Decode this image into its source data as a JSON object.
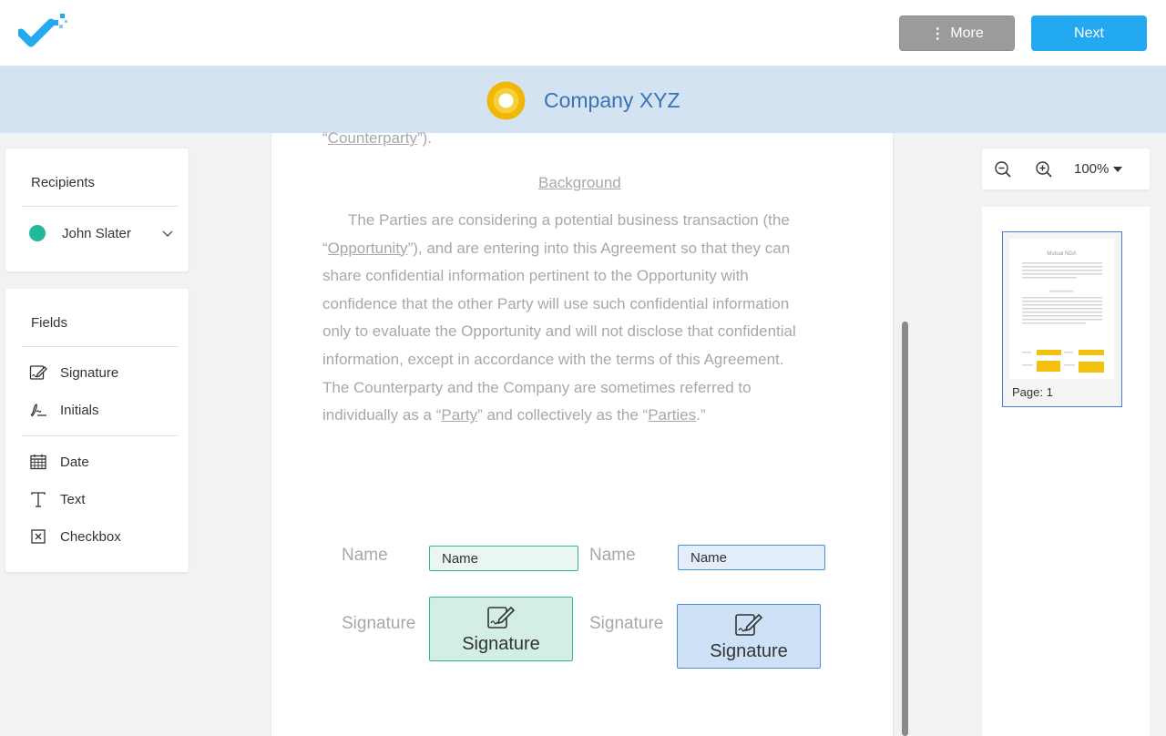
{
  "header": {
    "more_label": "More",
    "next_label": "Next"
  },
  "brand": {
    "company_name": "Company XYZ"
  },
  "sidebar": {
    "recipients_title": "Recipients",
    "recipient_name": "John Slater",
    "recipient_color": "#22b89a",
    "fields_title": "Fields",
    "fields": [
      {
        "label": "Signature",
        "icon": "signature-icon"
      },
      {
        "label": "Initials",
        "icon": "initials-icon"
      },
      {
        "label": "Date",
        "icon": "calendar-icon"
      },
      {
        "label": "Text",
        "icon": "text-icon"
      },
      {
        "label": "Checkbox",
        "icon": "checkbox-icon"
      }
    ]
  },
  "document": {
    "top_line_open": "“",
    "top_line_term": "Counterparty",
    "top_line_close": "”).",
    "section_heading": "Background",
    "paragraph": {
      "p1": "The Parties are considering a potential business transaction (the",
      "p2_open": "“",
      "p2_term": "Opportunity",
      "p2_rest": "”), and are entering into this Agreement so that they can",
      "p3": "share confidential information pertinent to the Opportunity with",
      "p4": "confidence that the other Party will use such confidential information",
      "p5": "only to evaluate the Opportunity and will not disclose that confidential",
      "p6": "information, except in accordance with the terms of this Agreement.",
      "p7": "The Counterparty and the Company are sometimes referred to",
      "p8_a": "individually as a “",
      "p8_term1": "Party",
      "p8_b": "” and collectively as the “",
      "p8_term2": "Parties",
      "p8_c": ".”"
    },
    "left_name_label": "Name",
    "left_name_field": "Name",
    "left_signature_label": "Signature",
    "left_signature_field": "Signature",
    "right_name_label": "Name",
    "right_name_field": "Name",
    "right_signature_label": "Signature",
    "right_signature_field": "Signature"
  },
  "viewer": {
    "zoom_level": "100%",
    "thumbnail_label": "Page: 1",
    "thumbnail_title": "Mutual NDA"
  },
  "colors": {
    "primary": "#22a9f0",
    "recipient_green": "#34b59a",
    "recipient_blue": "#4a8fd0",
    "brand_text": "#3a72b5"
  }
}
